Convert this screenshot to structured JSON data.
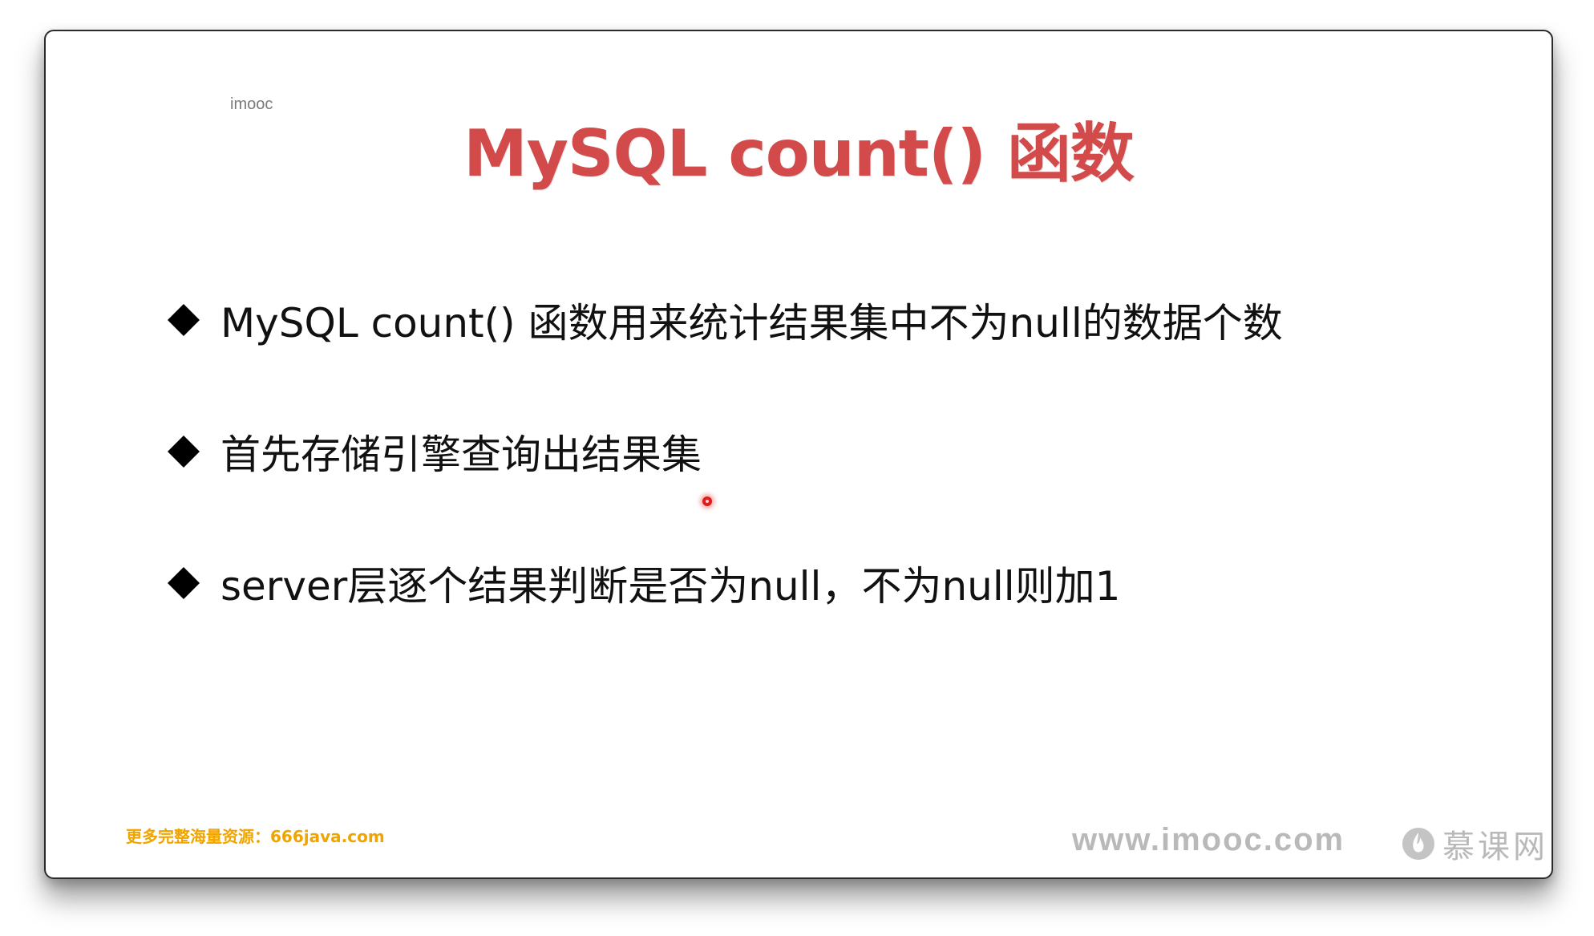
{
  "slide": {
    "corner_mark": "imooc",
    "title": "MySQL count() 函数",
    "bullets": [
      {
        "text": "MySQL count() 函数用来统计结果集中不为null的数据个数"
      },
      {
        "text": "首先存储引擎查询出结果集"
      },
      {
        "text": "server层逐个结果判断是否为null，不为null则加1"
      }
    ],
    "footer": {
      "resource_text": "更多完整海量资源：666java.com",
      "site_url": "www.imooc.com",
      "brand_name": "慕课网"
    },
    "colors": {
      "title": "#d24a4a",
      "body_text": "#111111",
      "resource_text": "#f0a400",
      "watermark": "#b9b9b9",
      "cursor": "#e01b1b"
    },
    "icons": {
      "bullet": "black-diamond-icon",
      "brand": "flame-logo-icon",
      "pointer": "laser-pointer-icon"
    }
  }
}
